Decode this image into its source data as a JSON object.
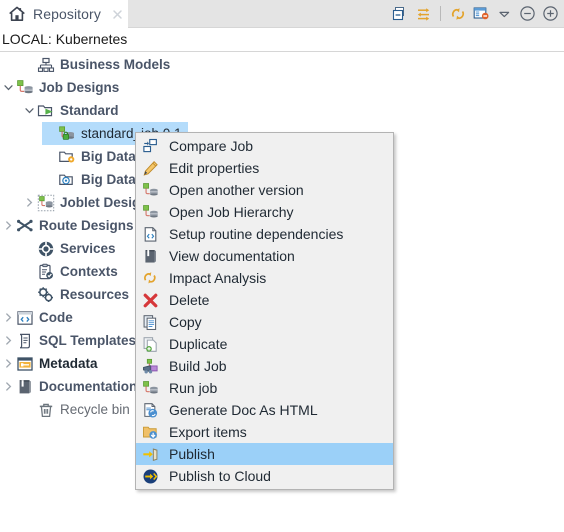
{
  "window": {
    "tab": {
      "label": "Repository",
      "icon": "home-icon",
      "close_icon": "close-icon"
    },
    "toolbar": [
      {
        "name": "collapse-all-icon",
        "title": "Collapse All"
      },
      {
        "name": "link-with-editor-icon",
        "title": "Link with Editor"
      },
      {
        "name": "refresh-icon",
        "title": "Refresh"
      },
      {
        "name": "filter-icon",
        "title": "Filter"
      },
      {
        "name": "view-menu-icon",
        "title": "View Menu"
      },
      {
        "name": "minimize-icon",
        "title": "Minimize"
      },
      {
        "name": "maximize-icon",
        "title": "Maximize"
      }
    ]
  },
  "repository": {
    "connection_label": "LOCAL: Kubernetes"
  },
  "tree": {
    "items": [
      {
        "label": "Business Models",
        "icon": "business-models-icon",
        "indent": 1,
        "twisty": "none",
        "style": "bold",
        "selected": false
      },
      {
        "label": "Job Designs",
        "icon": "job-designs-icon",
        "indent": 0,
        "twisty": "expanded",
        "style": "bold",
        "selected": false
      },
      {
        "label": "Standard",
        "icon": "standard-folder-icon",
        "indent": 1,
        "twisty": "expanded",
        "style": "bold",
        "selected": false
      },
      {
        "label": "standard_job 0.1",
        "icon": "job-item-icon",
        "indent": 2,
        "twisty": "none",
        "style": "plain",
        "selected": true
      },
      {
        "label": "Big Data Batch",
        "icon": "big-data-batch-icon",
        "indent": 2,
        "twisty": "none",
        "style": "bold",
        "selected": false
      },
      {
        "label": "Big Data Streaming",
        "icon": "big-data-streaming-icon",
        "indent": 2,
        "twisty": "none",
        "style": "bold",
        "selected": false
      },
      {
        "label": "Joblet Designs",
        "icon": "joblet-designs-icon",
        "indent": 1,
        "twisty": "collapsed",
        "style": "bold",
        "selected": false
      },
      {
        "label": "Route Designs",
        "icon": "route-designs-icon",
        "indent": 0,
        "twisty": "collapsed",
        "style": "bold",
        "selected": false
      },
      {
        "label": "Services",
        "icon": "services-icon",
        "indent": 1,
        "twisty": "none",
        "style": "bold",
        "selected": false
      },
      {
        "label": "Contexts",
        "icon": "contexts-icon",
        "indent": 1,
        "twisty": "none",
        "style": "bold",
        "selected": false
      },
      {
        "label": "Resources",
        "icon": "resources-icon",
        "indent": 1,
        "twisty": "none",
        "style": "bold",
        "selected": false
      },
      {
        "label": "Code",
        "icon": "code-icon",
        "indent": 0,
        "twisty": "collapsed",
        "style": "bold",
        "selected": false
      },
      {
        "label": "SQL Templates",
        "icon": "sql-templates-icon",
        "indent": 0,
        "twisty": "collapsed",
        "style": "bold",
        "selected": false
      },
      {
        "label": "Metadata",
        "icon": "metadata-icon",
        "indent": 0,
        "twisty": "collapsed",
        "style": "bold-dark",
        "selected": false
      },
      {
        "label": "Documentation",
        "icon": "documentation-icon",
        "indent": 0,
        "twisty": "collapsed",
        "style": "bold",
        "selected": false
      },
      {
        "label": "Recycle bin",
        "icon": "recycle-bin-icon",
        "indent": 1,
        "twisty": "none",
        "style": "plain",
        "selected": false
      }
    ]
  },
  "context_menu": {
    "items": [
      {
        "label": "Compare Job",
        "icon": "compare-job-icon",
        "highlighted": false
      },
      {
        "label": "Edit properties",
        "icon": "edit-properties-icon",
        "highlighted": false
      },
      {
        "label": "Open another version",
        "icon": "open-another-version-icon",
        "highlighted": false
      },
      {
        "label": "Open Job Hierarchy",
        "icon": "open-job-hierarchy-icon",
        "highlighted": false
      },
      {
        "label": "Setup routine dependencies",
        "icon": "setup-routine-dependencies-icon",
        "highlighted": false
      },
      {
        "label": "View documentation",
        "icon": "view-documentation-icon",
        "highlighted": false
      },
      {
        "label": "Impact Analysis",
        "icon": "impact-analysis-icon",
        "highlighted": false
      },
      {
        "label": "Delete",
        "icon": "delete-icon",
        "highlighted": false
      },
      {
        "label": "Copy",
        "icon": "copy-icon",
        "highlighted": false
      },
      {
        "label": "Duplicate",
        "icon": "duplicate-icon",
        "highlighted": false
      },
      {
        "label": "Build Job",
        "icon": "build-job-icon",
        "highlighted": false
      },
      {
        "label": "Run job",
        "icon": "run-job-icon",
        "highlighted": false
      },
      {
        "label": "Generate Doc As HTML",
        "icon": "generate-doc-as-html-icon",
        "highlighted": false
      },
      {
        "label": "Export items",
        "icon": "export-items-icon",
        "highlighted": false
      },
      {
        "label": "Publish",
        "icon": "publish-icon",
        "highlighted": true
      },
      {
        "label": "Publish to Cloud",
        "icon": "publish-to-cloud-icon",
        "highlighted": false
      }
    ]
  },
  "colors": {
    "selection": "#b4dcfb",
    "menu_highlight": "#9bd0f8",
    "menu_background": "#f0f0f0",
    "tab_inactive": "#e4e4e4",
    "tree_text": "#4a5568",
    "accent_orange": "#e8a33d"
  }
}
